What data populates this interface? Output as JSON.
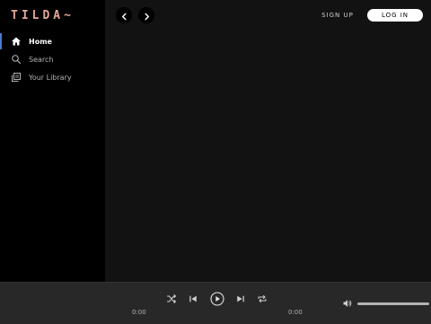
{
  "logo": {
    "text": "TILDA~"
  },
  "sidebar": {
    "items": [
      {
        "label": "Home",
        "icon": "home-icon",
        "active": true
      },
      {
        "label": "Search",
        "icon": "search-icon",
        "active": false
      },
      {
        "label": "Your Library",
        "icon": "library-icon",
        "active": false
      }
    ]
  },
  "header": {
    "back_icon": "chevron-left-icon",
    "forward_icon": "chevron-right-icon",
    "signup_label": "SIGN UP",
    "login_label": "LOG IN"
  },
  "player": {
    "elapsed": "0:00",
    "duration": "0:00",
    "controls": [
      "shuffle-icon",
      "previous-icon",
      "play-icon",
      "next-icon",
      "repeat-icon"
    ],
    "volume_icon": "volume-icon"
  },
  "colors": {
    "accent": "#4a7bd0",
    "logo": "#e3a79a",
    "sidebar_bg": "#000000",
    "main_bg": "#121212",
    "player_bg": "#282828"
  }
}
